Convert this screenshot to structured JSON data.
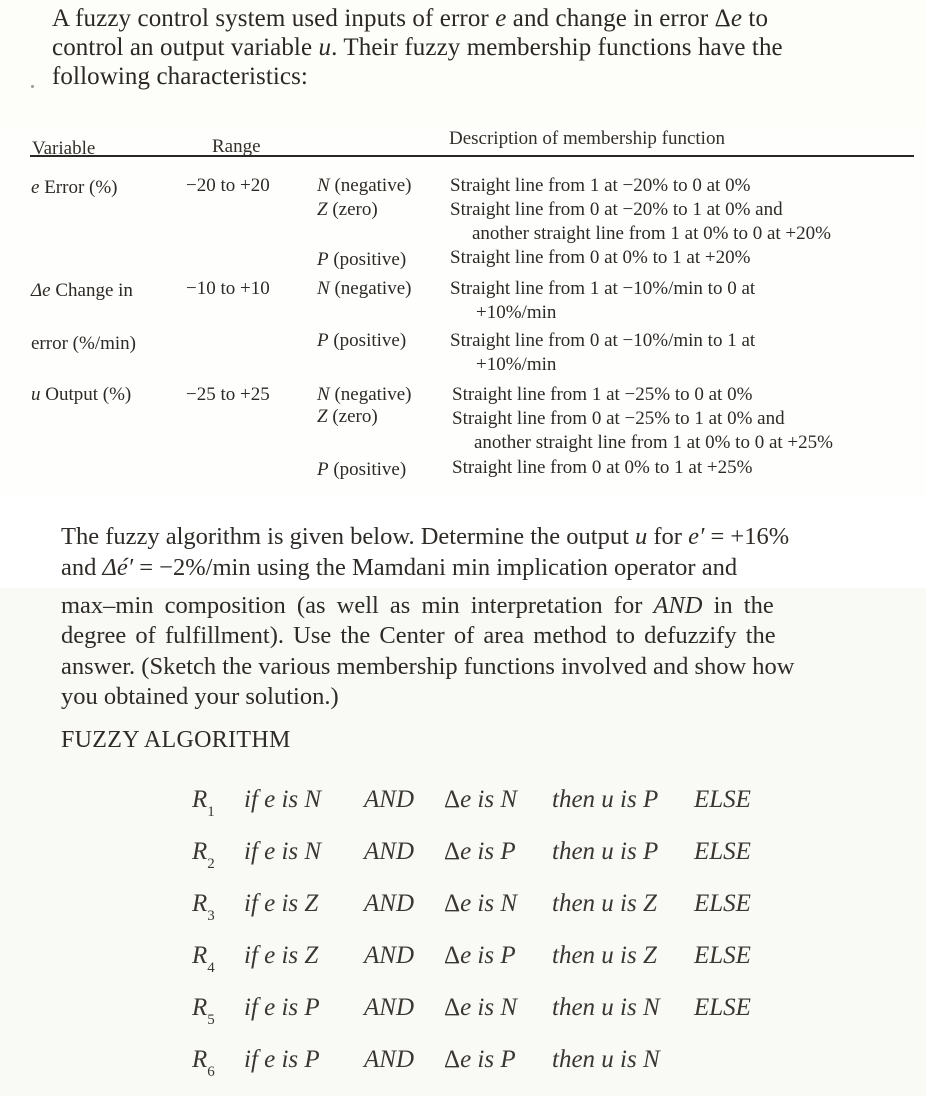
{
  "intro": {
    "line1_pre": "A fuzzy control system used inputs of error ",
    "var_e": "e",
    "line1_mid": " and change in error ",
    "delta": "Δ",
    "line1_post": " to",
    "line2_pre": "control an output variable ",
    "var_u": "u",
    "line2_post": ". Their fuzzy membership functions have the",
    "line3": "following characteristics:"
  },
  "table": {
    "headers": {
      "variable": "Variable",
      "range": "Range",
      "description": "Description of membership function"
    },
    "rows": [
      {
        "var_symbol": "e",
        "var_label": " Error (%)",
        "range": "−20 to +20",
        "sets": [
          {
            "set": "N",
            "label": " (negative)",
            "desc": [
              "Straight line from 1 at −20% to 0 at 0%"
            ]
          },
          {
            "set": "Z",
            "label": " (zero)",
            "desc": [
              "Straight line from 0 at −20% to 1 at 0% and",
              "another straight line from 1 at 0% to 0 at +20%"
            ]
          },
          {
            "set": "P",
            "label": " (positive)",
            "desc": [
              "Straight line from 0 at 0% to 1 at +20%"
            ]
          }
        ]
      },
      {
        "var_symbol": "Δe",
        "var_label": " Change in",
        "var_label2": "error (%/min)",
        "range": "−10 to +10",
        "sets": [
          {
            "set": "N",
            "label": " (negative)",
            "desc": [
              "Straight line from 1 at −10%/min to 0 at",
              "+10%/min"
            ]
          },
          {
            "set": "P",
            "label": " (positive)",
            "desc": [
              "Straight line from 0 at −10%/min to 1 at",
              "+10%/min"
            ]
          }
        ]
      },
      {
        "var_symbol": "u",
        "var_label": " Output (%)",
        "range": "−25 to +25",
        "sets": [
          {
            "set": "N",
            "label": " (negative)",
            "desc": [
              "Straight line from 1 at −25% to 0 at 0%"
            ]
          },
          {
            "set": "Z",
            "label": " (zero)",
            "desc": [
              "Straight line from 0 at −25% to 1 at 0% and",
              "another straight line from 1 at 0% to 0 at +25%"
            ]
          },
          {
            "set": "P",
            "label": " (positive)",
            "desc": [
              "Straight line from 0 at 0% to 1 at +25%"
            ]
          }
        ]
      }
    ]
  },
  "problem": {
    "l1_a": "The fuzzy algorithm is given below. Determine the output ",
    "l1_u": "u",
    "l1_b": " for ",
    "l1_e": "e′",
    "l1_c": " = +16%",
    "l2_a": "and ",
    "l2_de": "Δé′",
    "l2_b": " = −2%/min using the Mamdani min implication operator and",
    "l3_a": "max–min composition (as well as min interpretation for ",
    "l3_and": "AND",
    "l3_b": " in the",
    "l4": "degree of fulfillment). Use the Center of area method to defuzzify the",
    "l5": "answer. (Sketch the various membership functions involved and show how",
    "l6": "you obtained your solution.)"
  },
  "algorithm": {
    "title": "FUZZY ALGORITHM",
    "rules": [
      {
        "name": "R",
        "sub": "1",
        "cond_e": "if e is N",
        "and": "AND",
        "cond_de": "e is N",
        "then": "then u is P",
        "else": "ELSE"
      },
      {
        "name": "R",
        "sub": "2",
        "cond_e": "if e is N",
        "and": "AND",
        "cond_de": "e is P",
        "then": "then u is P",
        "else": "ELSE"
      },
      {
        "name": "R",
        "sub": "3",
        "cond_e": "if e is Z",
        "and": "AND",
        "cond_de": "e is N",
        "then": "then u is Z",
        "else": "ELSE"
      },
      {
        "name": "R",
        "sub": "4",
        "cond_e": "if e is Z",
        "and": "AND",
        "cond_de": "e is P",
        "then": "then u is Z",
        "else": "ELSE"
      },
      {
        "name": "R",
        "sub": "5",
        "cond_e": "if e is P",
        "and": "AND",
        "cond_de": "e is N",
        "then": "then u is N",
        "else": "ELSE"
      },
      {
        "name": "R",
        "sub": "6",
        "cond_e": "if e is P",
        "and": "AND",
        "cond_de": "e is P",
        "then": "then u is N",
        "else": ""
      }
    ],
    "delta": "Δ"
  }
}
